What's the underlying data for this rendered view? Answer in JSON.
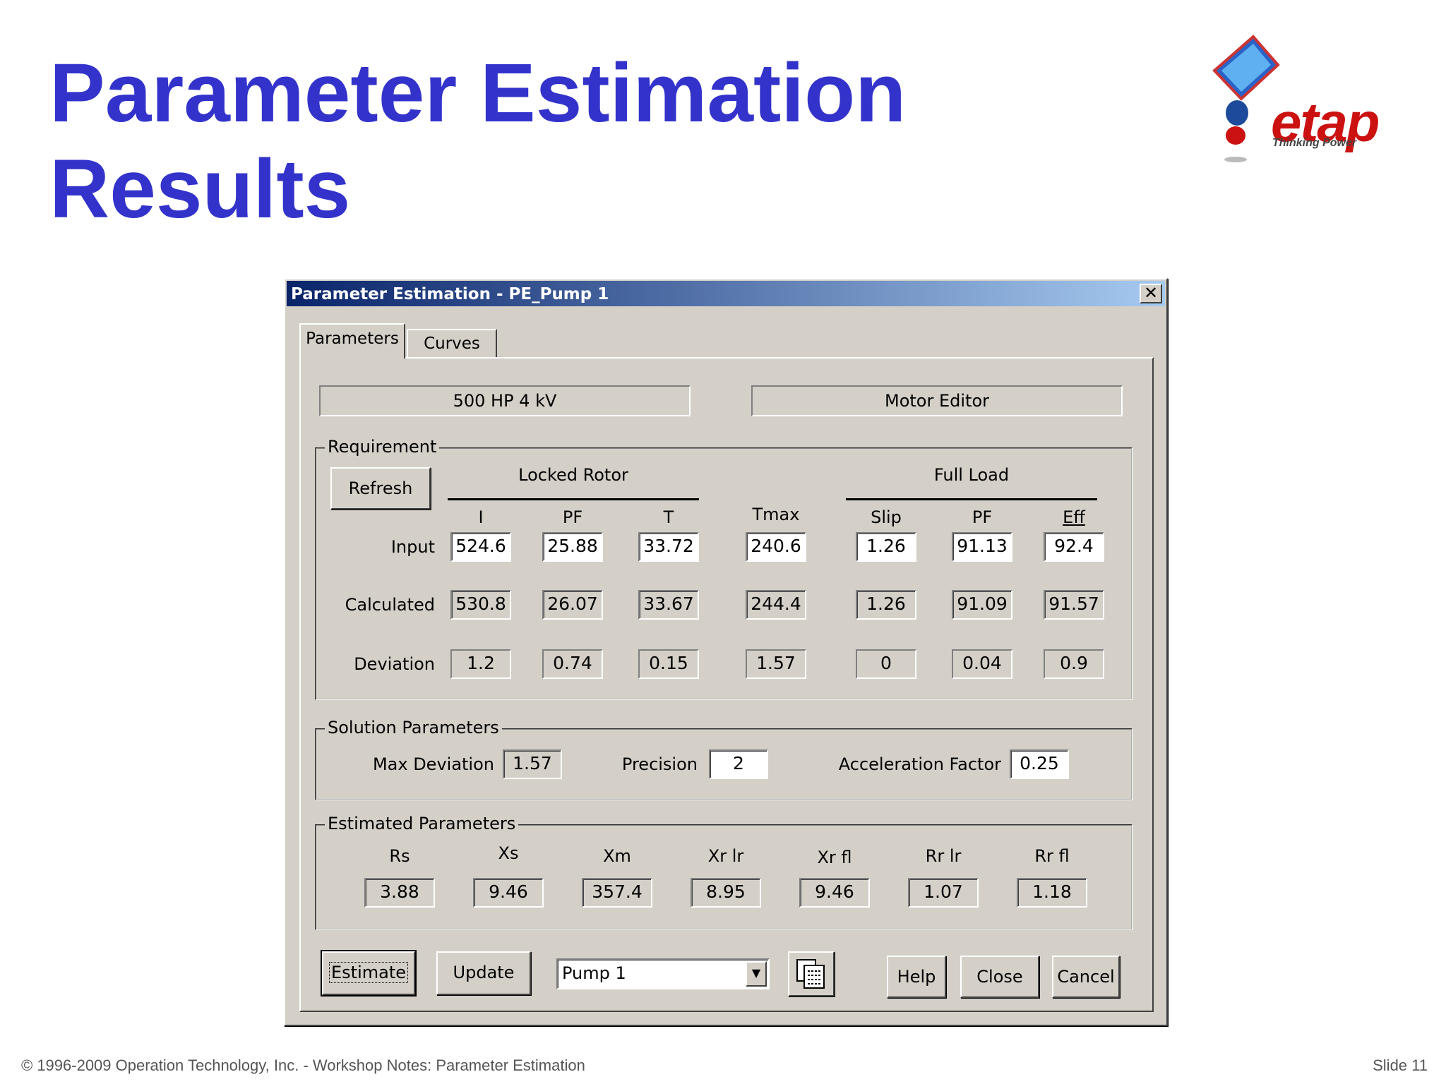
{
  "slide": {
    "title_line1": "Parameter Estimation",
    "title_line2": "Results",
    "logo_word": "etap",
    "logo_tagline": "Thinking Power",
    "footer_left": "© 1996-2009 Operation Technology, Inc. - Workshop Notes: Parameter Estimation",
    "footer_right": "Slide 11"
  },
  "dialog": {
    "title": "Parameter Estimation - PE_Pump 1",
    "close_glyph": "✕",
    "tabs": [
      {
        "label": "Parameters"
      },
      {
        "label": "Curves"
      }
    ],
    "rating": "500 HP   4 kV",
    "source": "Motor Editor",
    "requirement": {
      "group_label": "Requirement",
      "refresh_label": "Refresh",
      "locked_rotor_header": "Locked Rotor",
      "full_load_header": "Full Load",
      "columns": [
        "I",
        "PF",
        "T",
        "Tmax",
        "Slip",
        "PF",
        "Eff"
      ],
      "rows": [
        {
          "label": "Input",
          "values": [
            "524.6",
            "25.88",
            "33.72",
            "240.6",
            "1.26",
            "91.13",
            "92.4"
          ]
        },
        {
          "label": "Calculated",
          "values": [
            "530.8",
            "26.07",
            "33.67",
            "244.4",
            "1.26",
            "91.09",
            "91.57"
          ]
        },
        {
          "label": "Deviation",
          "values": [
            "1.2",
            "0.74",
            "0.15",
            "1.57",
            "0",
            "0.04",
            "0.9"
          ]
        }
      ]
    },
    "solution": {
      "group_label": "Solution Parameters",
      "max_deviation_label": "Max Deviation",
      "max_deviation": "1.57",
      "precision_label": "Precision",
      "precision": "2",
      "accel_label": "Acceleration Factor",
      "accel": "0.25"
    },
    "estimated": {
      "group_label": "Estimated Parameters",
      "columns": [
        "Rs",
        "Xs",
        "Xm",
        "Xr lr",
        "Xr fl",
        "Rr lr",
        "Rr fl"
      ],
      "values": [
        "3.88",
        "9.46",
        "357.4",
        "8.95",
        "9.46",
        "1.07",
        "1.18"
      ]
    },
    "buttons": {
      "estimate": "Estimate",
      "update": "Update",
      "help": "Help",
      "close": "Close",
      "cancel": "Cancel"
    },
    "library_select": "Pump 1",
    "icons": {
      "combo_arrow": "chevron-down-icon",
      "copy_button": "copy-icon",
      "close": "close-icon"
    }
  }
}
